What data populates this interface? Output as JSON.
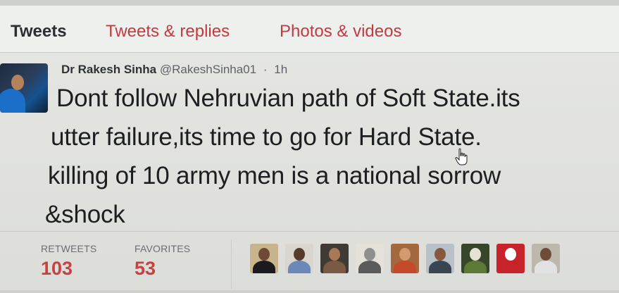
{
  "tabs": [
    {
      "label": "Tweets"
    },
    {
      "label": "Tweets & replies"
    },
    {
      "label": "Photos & videos"
    }
  ],
  "tweet": {
    "display_name": "Dr Rakesh Sinha",
    "handle": "@RakeshSinha01",
    "separator": "·",
    "time": "1h",
    "text_lines": [
      "Dont follow Nehruvian path of Soft State.its",
      "utter failure,its time to go for Hard State.",
      "killing of 10 army men is a national sorrow",
      "&shock"
    ]
  },
  "stats": {
    "retweets_label": "RETWEETS",
    "retweets_value": "103",
    "favorites_label": "FAVORITES",
    "favorites_value": "53"
  },
  "favoriters": [
    {
      "bg": "#c8b48c",
      "head": "#6b4a36",
      "body": "#1b1b1f"
    },
    {
      "bg": "#d8d6cf",
      "head": "#5a3a2a",
      "body": "#6c88b8"
    },
    {
      "bg": "#3f3a33",
      "head": "#a97856",
      "body": "#7a5a44"
    },
    {
      "bg": "#e4e1d8",
      "head": "#8f8f8f",
      "body": "#5b5b5b"
    },
    {
      "bg": "#a3683e",
      "head": "#d29a6d",
      "body": "#c44a2a"
    },
    {
      "bg": "#b8c1c8",
      "head": "#86593e",
      "body": "#3a4552"
    },
    {
      "bg": "#37452b",
      "head": "#e6e2d3",
      "body": "#5c7a36"
    },
    {
      "bg": "#c8232a",
      "head": "#ffffff",
      "body": "#c8232a"
    },
    {
      "bg": "#bcb8ae",
      "head": "#6f4c38",
      "body": "#e2e2e2"
    }
  ],
  "colors": {
    "accent": "#c9403f",
    "tab_link": "#c23a3f",
    "text": "#1c1e21"
  },
  "icons": {
    "cursor": "hand-pointer-icon"
  }
}
